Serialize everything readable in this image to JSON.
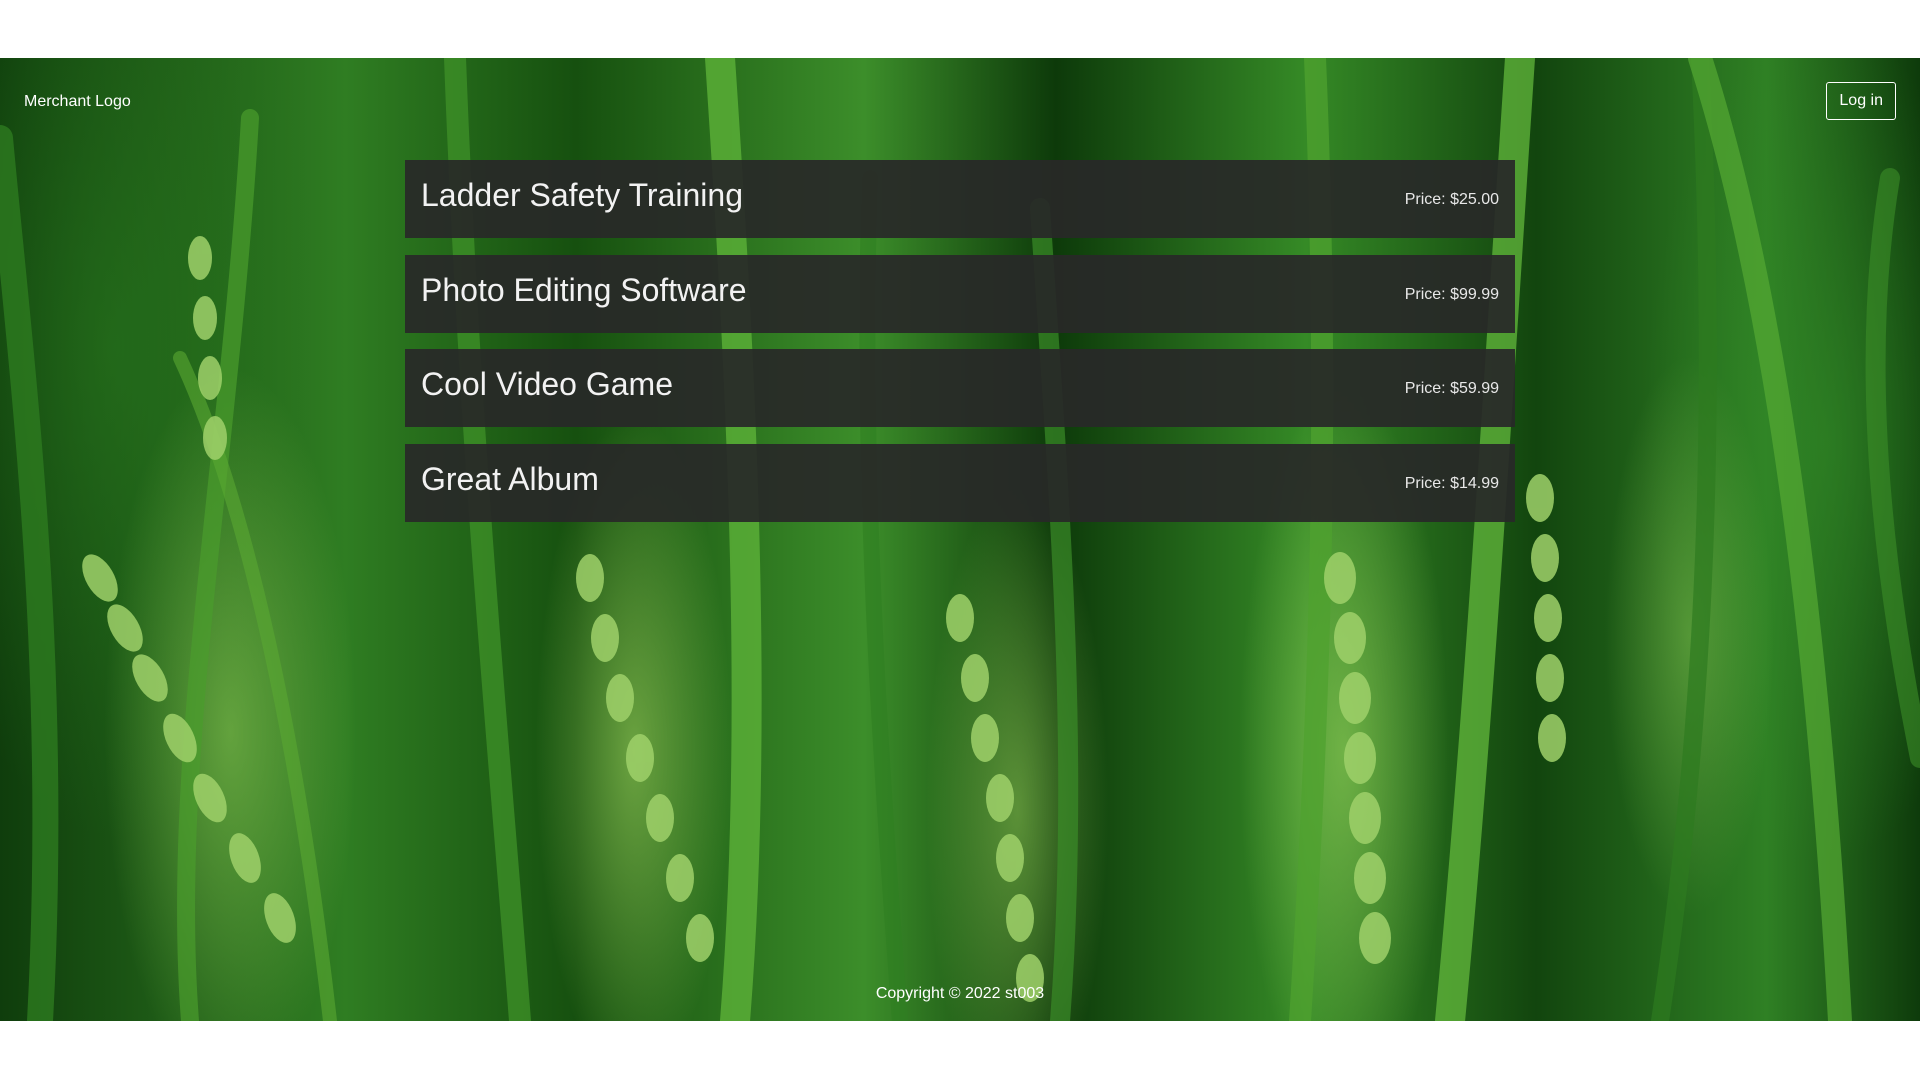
{
  "header": {
    "logo_text": "Merchant Logo",
    "login_label": "Log in"
  },
  "products": [
    {
      "name": "Ladder Safety Training",
      "price": "Price: $25.00"
    },
    {
      "name": "Photo Editing Software",
      "price": "Price: $99.99"
    },
    {
      "name": "Cool Video Game",
      "price": "Price: $59.99"
    },
    {
      "name": "Great Album",
      "price": "Price: $14.99"
    }
  ],
  "footer": {
    "copyright": "Copyright © 2022 st003"
  },
  "colors": {
    "page_background": "#ffffff",
    "card_background": "#282828",
    "text": "#ffffff"
  }
}
